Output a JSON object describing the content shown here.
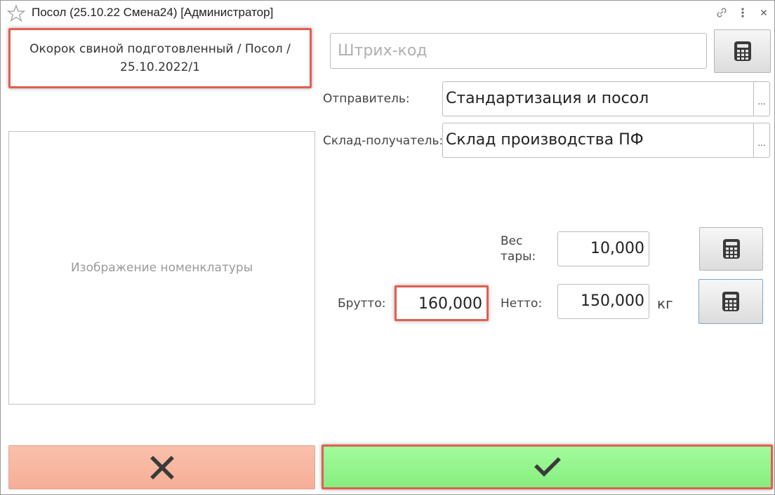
{
  "window": {
    "title": "Посол (25.10.22 Смена24) [Администратор]",
    "icons": [
      "star-icon",
      "link-icon",
      "more-icon",
      "close-icon"
    ]
  },
  "product": {
    "name": "Окорок свиной подготовленный / Посол / 25.10.2022/1"
  },
  "barcode": {
    "placeholder": "Штрих-код",
    "value": ""
  },
  "sender": {
    "label": "Отправитель:",
    "value": "Стандартизация и посол",
    "choose_label": "..."
  },
  "receiver": {
    "label": "Склад-получатель:",
    "value": "Склад производства ПФ",
    "choose_label": "..."
  },
  "image": {
    "placeholder": "Изображение номенклатуры"
  },
  "weights": {
    "tare_label_line1": "Вес",
    "tare_label_line2": "тары:",
    "tare_value": "10,000",
    "gross_label": "Брутто:",
    "gross_value": "160,000",
    "net_label": "Нетто:",
    "net_value": "150,000",
    "unit": "кг"
  },
  "actions": {
    "cancel_icon": "close-x-icon",
    "ok_icon": "checkmark-icon"
  },
  "colors": {
    "highlight": "#e05f4f",
    "cancel_bg": "#f8b6a0",
    "ok_bg": "#95f48e",
    "icon_dark": "#3a3a3a"
  }
}
